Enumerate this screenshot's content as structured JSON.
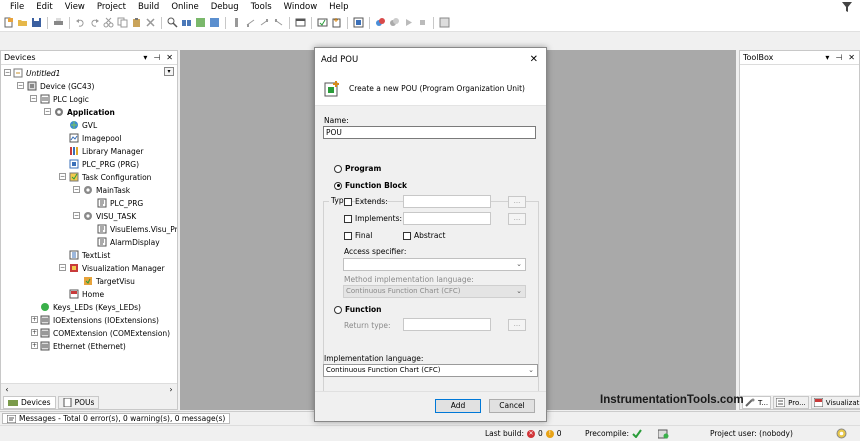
{
  "menubar": {
    "items": [
      "File",
      "Edit",
      "View",
      "Project",
      "Build",
      "Online",
      "Debug",
      "Tools",
      "Window",
      "Help"
    ]
  },
  "devices_panel": {
    "title": "Devices",
    "tree": [
      {
        "label": "Untitled1",
        "depth": 0
      },
      {
        "label": "Device (GC43)",
        "depth": 1
      },
      {
        "label": "PLC Logic",
        "depth": 2
      },
      {
        "label": "Application",
        "depth": 3
      },
      {
        "label": "GVL",
        "depth": 4
      },
      {
        "label": "Imagepool",
        "depth": 4
      },
      {
        "label": "Library Manager",
        "depth": 4
      },
      {
        "label": "PLC_PRG (PRG)",
        "depth": 4
      },
      {
        "label": "Task Configuration",
        "depth": 4
      },
      {
        "label": "MainTask",
        "depth": 5
      },
      {
        "label": "PLC_PRG",
        "depth": 6
      },
      {
        "label": "VISU_TASK",
        "depth": 5
      },
      {
        "label": "VisuElems.Visu_Prg",
        "depth": 6
      },
      {
        "label": "AlarmDisplay",
        "depth": 6
      },
      {
        "label": "TextList",
        "depth": 4
      },
      {
        "label": "Visualization Manager",
        "depth": 4
      },
      {
        "label": "TargetVisu",
        "depth": 5
      },
      {
        "label": "Home",
        "depth": 4
      },
      {
        "label": "Keys_LEDs (Keys_LEDs)",
        "depth": 2
      },
      {
        "label": "IOExtensions (IOExtensions)",
        "depth": 2
      },
      {
        "label": "COMExtension (COMExtension)",
        "depth": 2
      },
      {
        "label": "Ethernet (Ethernet)",
        "depth": 2
      }
    ],
    "tabs": [
      "Devices",
      "POUs"
    ]
  },
  "toolbox": {
    "title": "ToolBox",
    "tabs": [
      "T...",
      "Pro...",
      "Visualizati..."
    ]
  },
  "dialog": {
    "title": "Add POU",
    "header_text": "Create a new POU (Program Organization Unit)",
    "name_label": "Name:",
    "name_value": "POU",
    "type_label": "Type",
    "program_label": "Program",
    "function_block_label": "Function Block",
    "extends_label": "Extends:",
    "implements_label": "Implements:",
    "browse_label": "...",
    "final_label": "Final",
    "abstract_label": "Abstract",
    "access_label": "Access specifier:",
    "method_lang_label": "Method implementation language:",
    "method_lang_value": "Continuous Function Chart (CFC)",
    "function_label": "Function",
    "return_type_label": "Return type:",
    "impl_lang_label": "Implementation language:",
    "impl_lang_value": "Continuous Function Chart (CFC)",
    "add_label": "Add",
    "cancel_label": "Cancel",
    "selected_type": "Function Block"
  },
  "watermark": "InstrumentationTools.com",
  "messages": {
    "label": "Messages - Total 0 error(s), 0 warning(s), 0 message(s)"
  },
  "statusbar": {
    "last_build_label": "Last build:",
    "errors": "0",
    "warnings": "0",
    "precompile_label": "Precompile:",
    "project_user": "Project user: (nobody)"
  }
}
